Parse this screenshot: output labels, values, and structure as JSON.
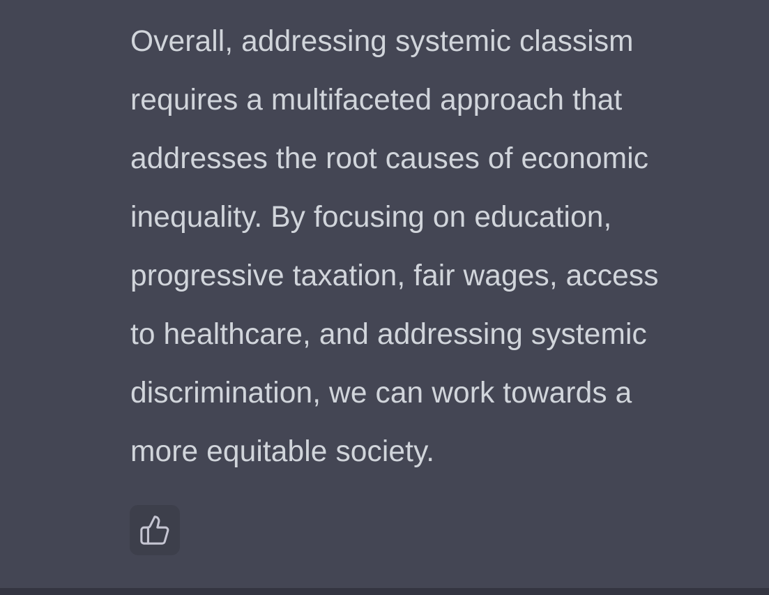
{
  "message": {
    "lines": [
      "Overall, addressing systemic classism",
      "requires a multifaceted approach that",
      "addresses the root causes of economic",
      "inequality. By focusing on education,",
      "progressive taxation, fair wages, access",
      "to healthcare, and addressing systemic",
      "discrimination, we can work towards a",
      "more equitable society."
    ]
  },
  "actions": {
    "thumbs_up_icon": "thumbs-up-icon"
  },
  "colors": {
    "background": "#444654",
    "text": "#d1d5db",
    "button_background": "#3d3f4b",
    "icon": "#c5c5d2",
    "bottom_bar": "#343541"
  }
}
